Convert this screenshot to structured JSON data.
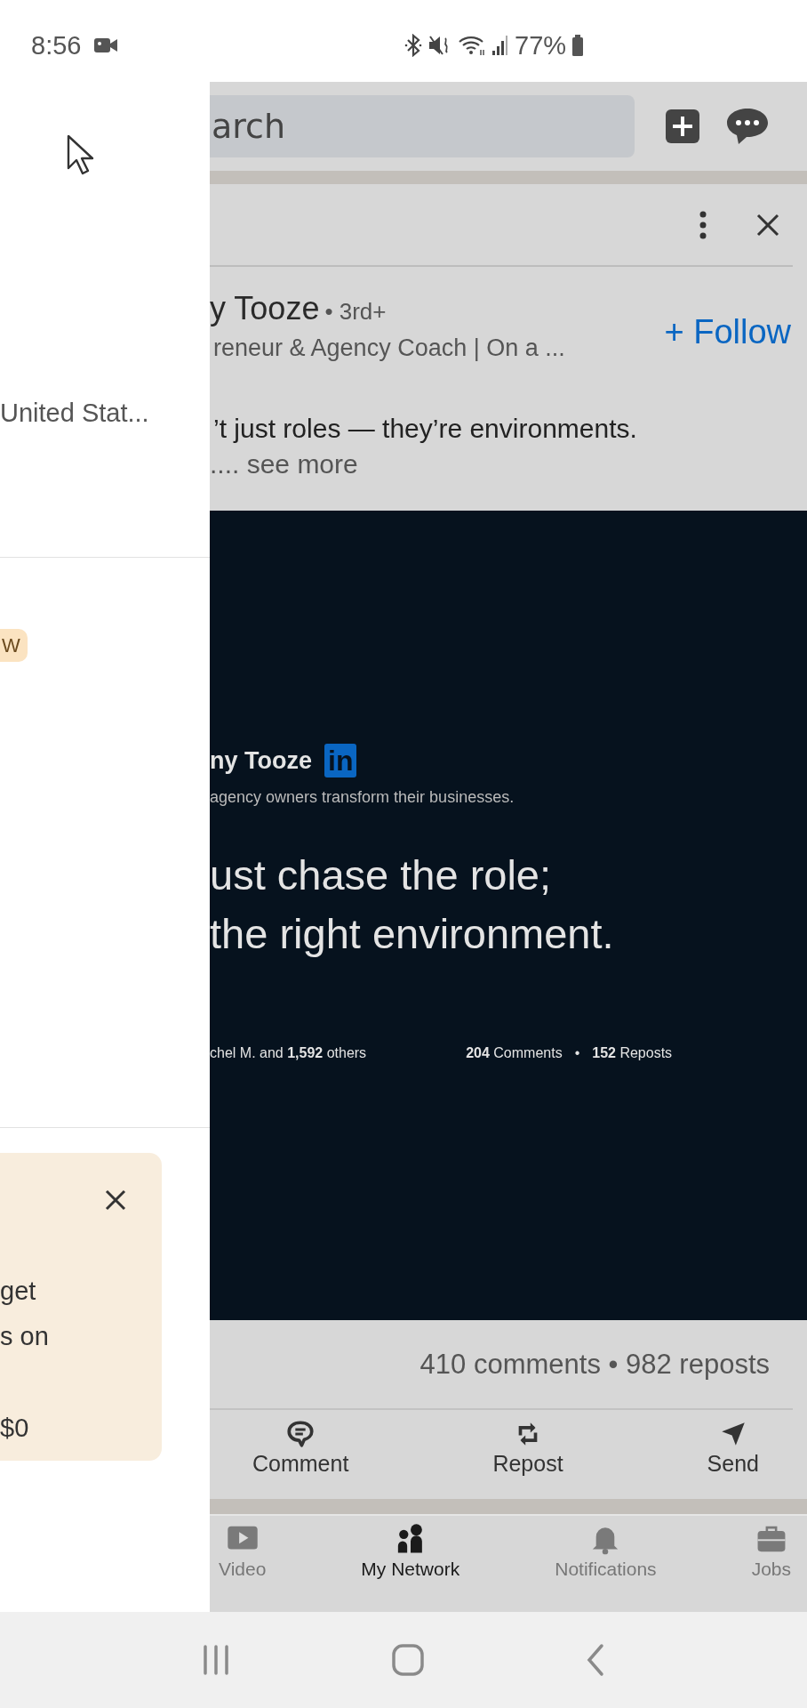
{
  "status_bar": {
    "time": "8:56",
    "battery": "77%"
  },
  "drawer": {
    "location": "United Stat...",
    "badge": "W",
    "promo": {
      "lines": [
        "get",
        "s on"
      ],
      "price": "$0"
    }
  },
  "top_bar": {
    "search": {
      "placeholder": "arch"
    }
  },
  "post": {
    "author": "y Tooze",
    "degree": "• 3rd+",
    "headline": "reneur & Agency Coach | On a ...",
    "follow": "+ Follow",
    "text": "’t just roles — they’re environments.",
    "see_more": ".... see more",
    "image": {
      "name": "ny Tooze",
      "logo": "in",
      "tagline": "agency owners transform their businesses.",
      "quote": [
        "ust chase the role;",
        "the right environment."
      ],
      "reactions": "chel M. and **1,592** others",
      "comments": "**204** Comments",
      "separator": "•",
      "reposts": "**152** Reposts"
    },
    "stats": "410 comments • 982 reposts",
    "actions": [
      {
        "label": "Comment",
        "kind": "comment"
      },
      {
        "label": "Repost",
        "kind": "repost"
      },
      {
        "label": "Send",
        "kind": "send"
      }
    ]
  },
  "bottom_nav": [
    {
      "label": "Video",
      "kind": "video",
      "selected": false
    },
    {
      "label": "My Network",
      "kind": "network",
      "selected": true
    },
    {
      "label": "Notifications",
      "kind": "bell",
      "selected": false
    },
    {
      "label": "Jobs",
      "kind": "jobs",
      "selected": false
    }
  ]
}
